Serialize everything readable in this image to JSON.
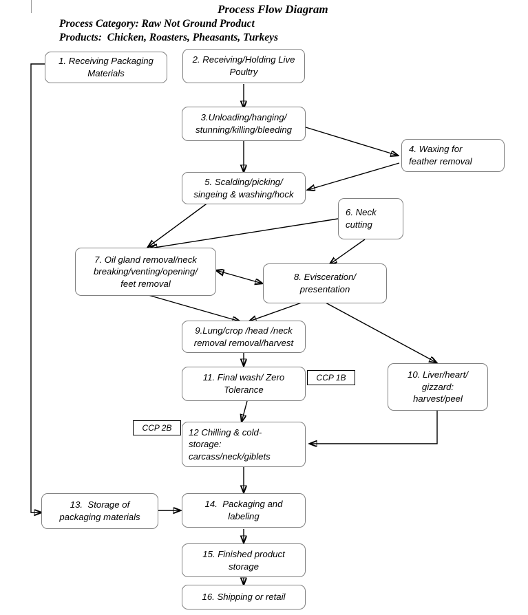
{
  "header": {
    "title": "Process Flow Diagram",
    "process_category": "Process Category: Raw Not Ground Product",
    "products": "Products:  Chicken, Roasters, Pheasants, Turkeys"
  },
  "colors": {
    "box_border": "#808080",
    "edge": "#000000",
    "text": "#000000",
    "background": "#ffffff",
    "ccp_border": "#000000"
  },
  "nodes": [
    {
      "id": "n1",
      "number": "1.",
      "lines": [
        "1. Receiving Packaging",
        "Materials"
      ],
      "align": "center"
    },
    {
      "id": "n2",
      "number": "2.",
      "lines": [
        "2. Receiving/Holding Live",
        "Poultry"
      ],
      "align": "center"
    },
    {
      "id": "n3",
      "number": "3.",
      "lines": [
        "3.Unloading/hanging/",
        "stunning/killing/bleeding"
      ],
      "align": "center"
    },
    {
      "id": "n4",
      "number": "4.",
      "lines": [
        "4. Waxing for",
        "feather removal"
      ],
      "align": "left"
    },
    {
      "id": "n5",
      "number": "5.",
      "lines": [
        "5. Scalding/picking/",
        "singeing & washing/hock"
      ],
      "align": "center"
    },
    {
      "id": "n6",
      "number": "6.",
      "lines": [
        "6. Neck",
        "cutting"
      ],
      "align": "left"
    },
    {
      "id": "n7",
      "number": "7.",
      "lines": [
        "7. Oil gland removal/neck",
        "breaking/venting/opening/",
        "feet removal"
      ],
      "align": "center"
    },
    {
      "id": "n8",
      "number": "8.",
      "lines": [
        "8. Evisceration/",
        "presentation"
      ],
      "align": "center"
    },
    {
      "id": "n9",
      "number": "9.",
      "lines": [
        "9.Lung/crop /head /neck",
        "removal removal/harvest"
      ],
      "align": "center"
    },
    {
      "id": "n10",
      "number": "10.",
      "lines": [
        "10. Liver/heart/",
        "gizzard:",
        "harvest/peel"
      ],
      "align": "center"
    },
    {
      "id": "n11",
      "number": "11.",
      "lines": [
        "11. Final wash/ Zero",
        "Tolerance"
      ],
      "align": "center"
    },
    {
      "id": "n12",
      "number": "12",
      "lines": [
        "12 Chilling & cold-",
        "storage:",
        "carcass/neck/giblets"
      ],
      "align": "left"
    },
    {
      "id": "n13",
      "number": "13.",
      "lines": [
        "13.  Storage of",
        "packaging materials"
      ],
      "align": "center"
    },
    {
      "id": "n14",
      "number": "14.",
      "lines": [
        "14.  Packaging and",
        "labeling"
      ],
      "align": "center"
    },
    {
      "id": "n15",
      "number": "15.",
      "lines": [
        "15. Finished product",
        "storage"
      ],
      "align": "center"
    },
    {
      "id": "n16",
      "number": "16.",
      "lines": [
        "16. Shipping or retail"
      ],
      "align": "center"
    }
  ],
  "ccp_labels": [
    {
      "id": "ccp1b",
      "text": "CCP 1B",
      "attached_to": "11"
    },
    {
      "id": "ccp2b",
      "text": "CCP 2B",
      "attached_to": "12"
    }
  ],
  "edges": [
    {
      "from": "2",
      "to": "3",
      "type": "straight-down"
    },
    {
      "from": "3",
      "to": "5",
      "type": "straight-down"
    },
    {
      "from": "3",
      "to": "4",
      "type": "diagonal"
    },
    {
      "from": "4",
      "to": "5",
      "type": "diagonal"
    },
    {
      "from": "5",
      "to": "7",
      "type": "diagonal"
    },
    {
      "from": "6",
      "to": "7",
      "type": "diagonal"
    },
    {
      "from": "6",
      "to": "8",
      "type": "diagonal"
    },
    {
      "from": "7",
      "to": "8",
      "type": "bidirectional"
    },
    {
      "from": "7",
      "to": "9",
      "type": "diagonal"
    },
    {
      "from": "8",
      "to": "9",
      "type": "diagonal"
    },
    {
      "from": "8",
      "to": "10",
      "type": "diagonal"
    },
    {
      "from": "9",
      "to": "11",
      "type": "straight-down"
    },
    {
      "from": "11",
      "to": "12",
      "type": "straight-down"
    },
    {
      "from": "10",
      "to": "12",
      "type": "elbow"
    },
    {
      "from": "12",
      "to": "14",
      "type": "straight-down"
    },
    {
      "from": "1",
      "to": "13",
      "type": "elbow-left"
    },
    {
      "from": "13",
      "to": "14",
      "type": "straight-right"
    },
    {
      "from": "14",
      "to": "15",
      "type": "straight-down"
    },
    {
      "from": "15",
      "to": "16",
      "type": "straight-down"
    }
  ]
}
